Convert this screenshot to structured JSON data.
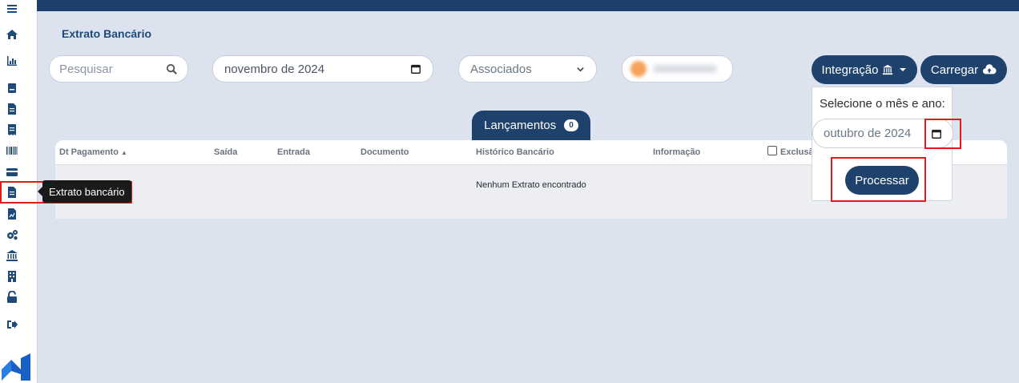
{
  "sidebar": {
    "icons": [
      "menu-icon",
      "home-icon",
      "chart-icon",
      "book-icon",
      "document-icon",
      "receipt-icon",
      "barcode-icon",
      "card-icon",
      "statement-icon",
      "report-icon",
      "gears-icon",
      "bank-icon",
      "building-icon",
      "unlock-icon",
      "logout-icon"
    ],
    "tooltip": "Extrato bancário"
  },
  "page": {
    "title": "Extrato Bancário"
  },
  "filters": {
    "search_placeholder": "Pesquisar",
    "month_value": "novembro de 2024",
    "associados_value": "Associados"
  },
  "toolbar": {
    "integracao_label": "Integração",
    "carregar_label": "Carregar"
  },
  "dropdown": {
    "label": "Selecione o mês e ano:",
    "month_value": "outubro de 2024",
    "processar_label": "Processar"
  },
  "tab": {
    "label": "Lançamentos",
    "count": "0"
  },
  "table": {
    "columns": [
      "Dt Pagamento",
      "Saída",
      "Entrada",
      "Documento",
      "Histórico Bancário",
      "Informação",
      "Exclusão"
    ],
    "empty_message": "Nenhum Extrato encontrado"
  },
  "colors": {
    "primary": "#1f426c",
    "highlight": "#e01b1b",
    "background": "#dde3ee"
  }
}
